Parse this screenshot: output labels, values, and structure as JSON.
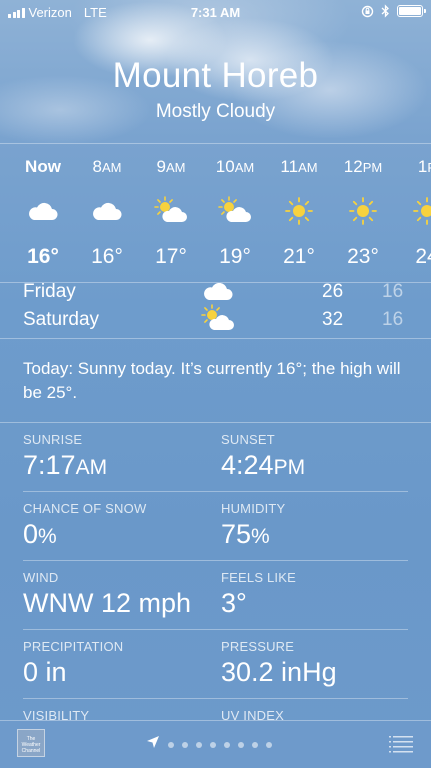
{
  "status_bar": {
    "carrier": "Verizon",
    "network": "LTE",
    "time": "7:31 AM"
  },
  "header": {
    "city": "Mount Horeb",
    "condition": "Mostly Cloudy"
  },
  "hourly": [
    {
      "label": "Now",
      "suffix": "",
      "icon": "cloud-icon",
      "temp": "16°"
    },
    {
      "label": "8",
      "suffix": "AM",
      "icon": "cloud-icon",
      "temp": "16°"
    },
    {
      "label": "9",
      "suffix": "AM",
      "icon": "partly-sunny-icon",
      "temp": "17°"
    },
    {
      "label": "10",
      "suffix": "AM",
      "icon": "partly-sunny-icon",
      "temp": "19°"
    },
    {
      "label": "11",
      "suffix": "AM",
      "icon": "sun-icon",
      "temp": "21°"
    },
    {
      "label": "12",
      "suffix": "PM",
      "icon": "sun-icon",
      "temp": "23°"
    },
    {
      "label": "1",
      "suffix": "P",
      "icon": "sun-icon",
      "temp": "24"
    }
  ],
  "daily": [
    {
      "day": "Friday",
      "icon": "cloud-icon",
      "high": "26",
      "low": "16"
    },
    {
      "day": "Saturday",
      "icon": "partly-sunny-icon",
      "high": "32",
      "low": "16"
    }
  ],
  "summary": "Today: Sunny today. It’s currently 16°; the high will be 25°.",
  "details": [
    {
      "left": {
        "label": "SUNRISE",
        "value": "7:17",
        "unit": "AM"
      },
      "right": {
        "label": "SUNSET",
        "value": "4:24",
        "unit": "PM"
      }
    },
    {
      "left": {
        "label": "CHANCE OF SNOW",
        "value": "0",
        "unit": "%"
      },
      "right": {
        "label": "HUMIDITY",
        "value": "75",
        "unit": "%"
      }
    },
    {
      "left": {
        "label": "WIND",
        "value": "WNW 12 mph",
        "unit": ""
      },
      "right": {
        "label": "FEELS LIKE",
        "value": "3°",
        "unit": ""
      }
    },
    {
      "left": {
        "label": "PRECIPITATION",
        "value": "0 in",
        "unit": ""
      },
      "right": {
        "label": "PRESSURE",
        "value": "30.2 inHg",
        "unit": ""
      }
    },
    {
      "left": {
        "label": "VISIBILITY",
        "value": "",
        "unit": ""
      },
      "right": {
        "label": "UV INDEX",
        "value": "",
        "unit": ""
      }
    }
  ],
  "bottom_bar": {
    "logo_text": "The Weather Channel",
    "page_count": 8
  }
}
